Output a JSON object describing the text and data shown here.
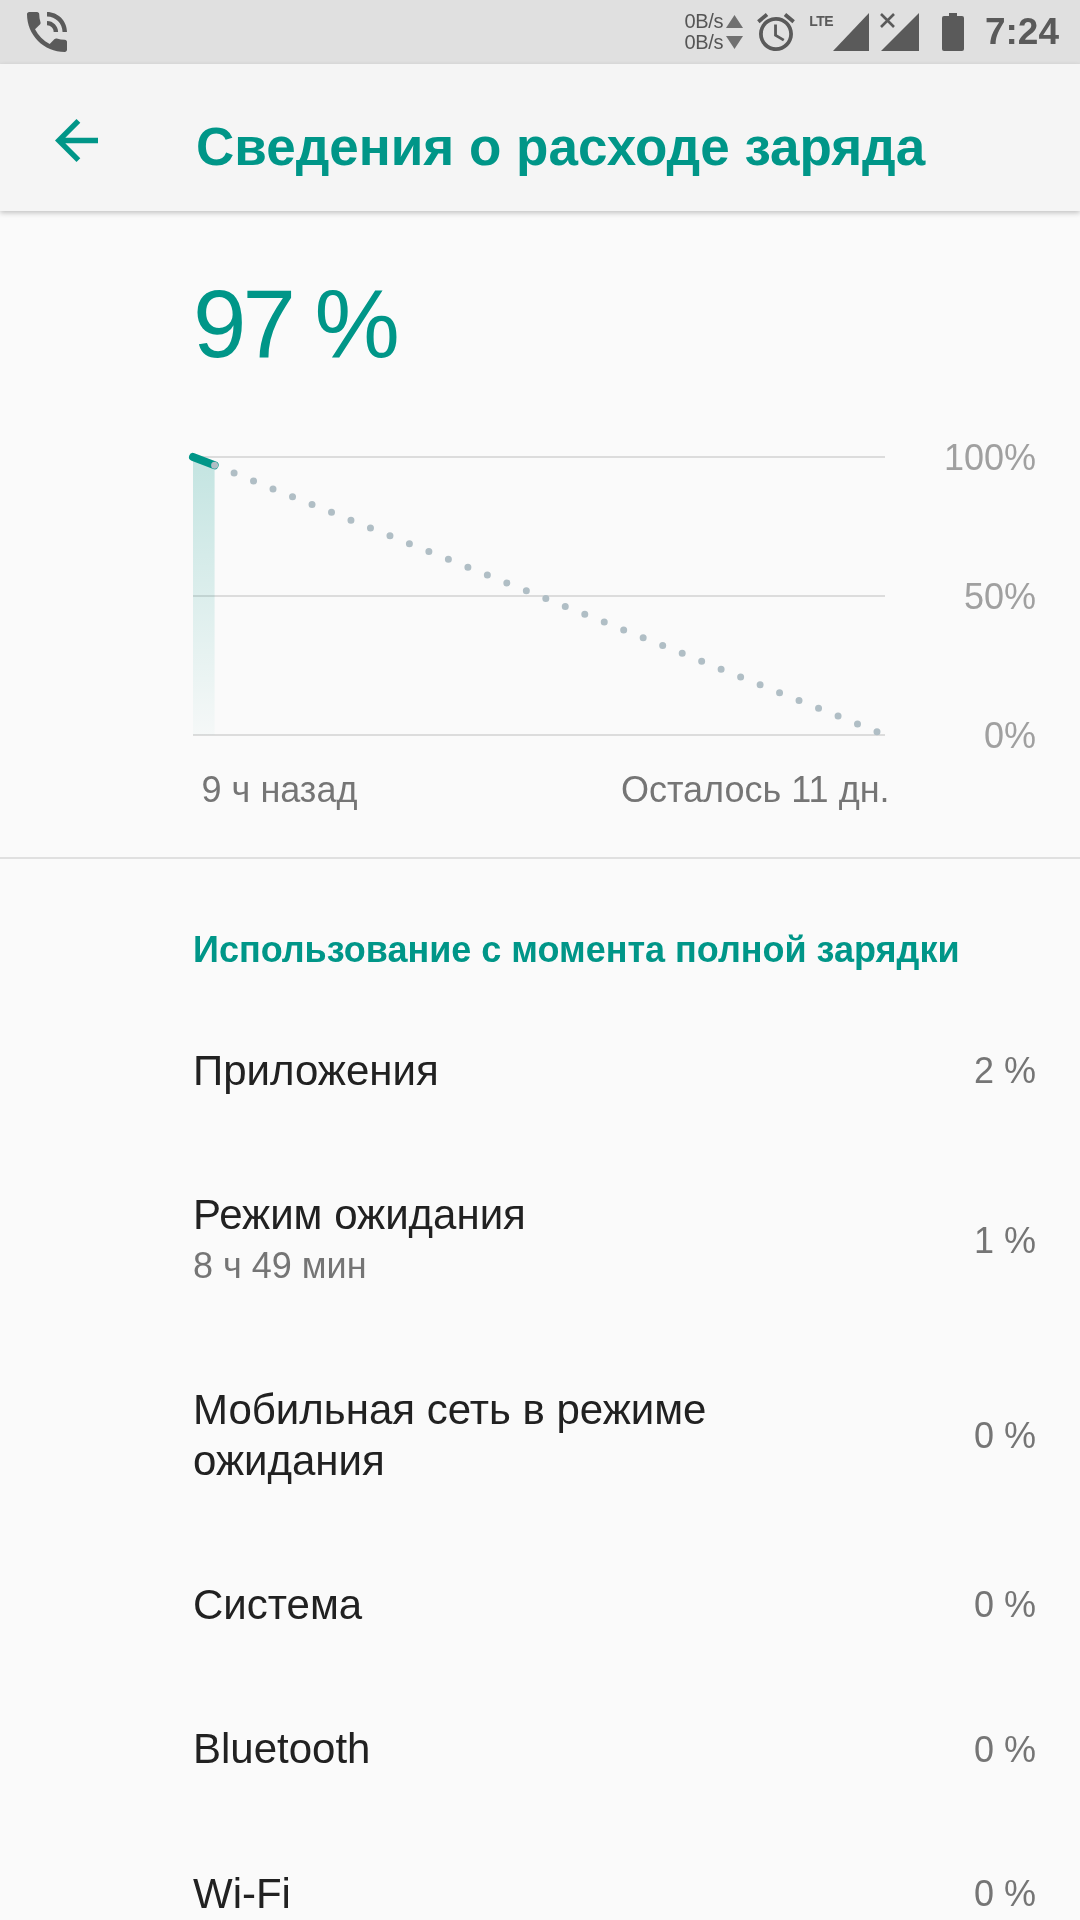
{
  "status_bar": {
    "network_speed": [
      "0B/s",
      "0B/s"
    ],
    "network_type": "LTE",
    "time": "7:24"
  },
  "app_bar": {
    "title": "Сведения о расходе заряда"
  },
  "battery": {
    "percent_text": "97 %",
    "chart_data": {
      "type": "area",
      "categories": [
        null,
        null,
        null,
        null,
        "9 ч назад",
        null,
        null,
        null,
        null,
        null,
        null,
        null,
        null,
        null,
        null,
        null,
        null,
        null,
        null,
        null,
        null,
        null,
        null,
        null,
        null,
        null,
        "Осталось 11 дн.",
        null,
        null,
        null,
        null,
        null,
        null
      ],
      "ylim": [
        0,
        100
      ],
      "yticks": [
        {
          "value": 0,
          "label": "0%"
        },
        {
          "value": 50,
          "label": "50%"
        },
        {
          "value": 100,
          "label": "100%"
        }
      ],
      "series": [
        {
          "color": "#009688",
          "values": [
            100,
            97,
            null,
            null,
            null,
            null,
            null,
            null,
            null,
            null,
            null,
            null,
            null,
            null,
            null,
            null,
            null,
            null,
            null,
            null,
            null,
            null,
            null,
            null,
            null,
            null,
            null,
            null,
            null,
            null,
            null,
            null,
            null
          ]
        },
        {
          "type": "line",
          "color": "#b0bec5",
          "line_style": "dotted",
          "values": [
            null,
            97,
            93.9,
            90.7,
            87.6,
            84.5,
            81.4,
            78.2,
            75.1,
            72.0,
            68.8,
            65.7,
            62.6,
            59.5,
            56.3,
            53.2,
            50.1,
            46.9,
            43.8,
            40.7,
            37.5,
            34.4,
            31.3,
            28.2,
            25.0,
            21.9,
            18.8,
            15.6,
            12.5,
            9.4,
            6.3,
            3.1,
            0
          ]
        }
      ]
    }
  },
  "usage": {
    "header": "Использование с момента полной зарядки",
    "items": [
      {
        "title": "Приложения",
        "percent": "2 %"
      },
      {
        "title": "Режим ожидания",
        "summary": "8 ч 49 мин",
        "percent": "1 %"
      },
      {
        "title": "Мобильная сеть в режиме ожидания",
        "percent": "0 %"
      },
      {
        "title": "Система",
        "percent": "0 %"
      },
      {
        "title": "Bluetooth",
        "percent": "0 %"
      },
      {
        "title": "Wi-Fi",
        "percent": "0 %"
      }
    ]
  }
}
